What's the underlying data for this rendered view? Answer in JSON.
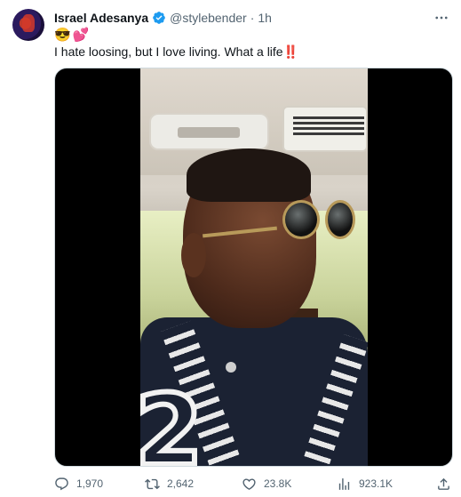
{
  "author": {
    "name": "Israel Adesanya",
    "handle": "@stylebender",
    "separator": "·",
    "time": "1h"
  },
  "tweet": {
    "emojis": [
      "😎",
      "💕"
    ],
    "text": "I hate loosing, but I love living. What a life",
    "text_suffix": "‼️"
  },
  "media": {
    "type": "video"
  },
  "actions": {
    "replies": "1,970",
    "retweets": "2,642",
    "likes": "23.8K",
    "views": "923.1K"
  },
  "icons": {
    "verified": "verified-badge-icon",
    "more": "more-options-icon",
    "reply": "reply-icon",
    "retweet": "retweet-icon",
    "like": "heart-icon",
    "views": "views-chart-icon",
    "share": "share-icon"
  },
  "colors": {
    "verified": "#1d9bf0",
    "text": "#0f1419",
    "secondary": "#536471"
  }
}
